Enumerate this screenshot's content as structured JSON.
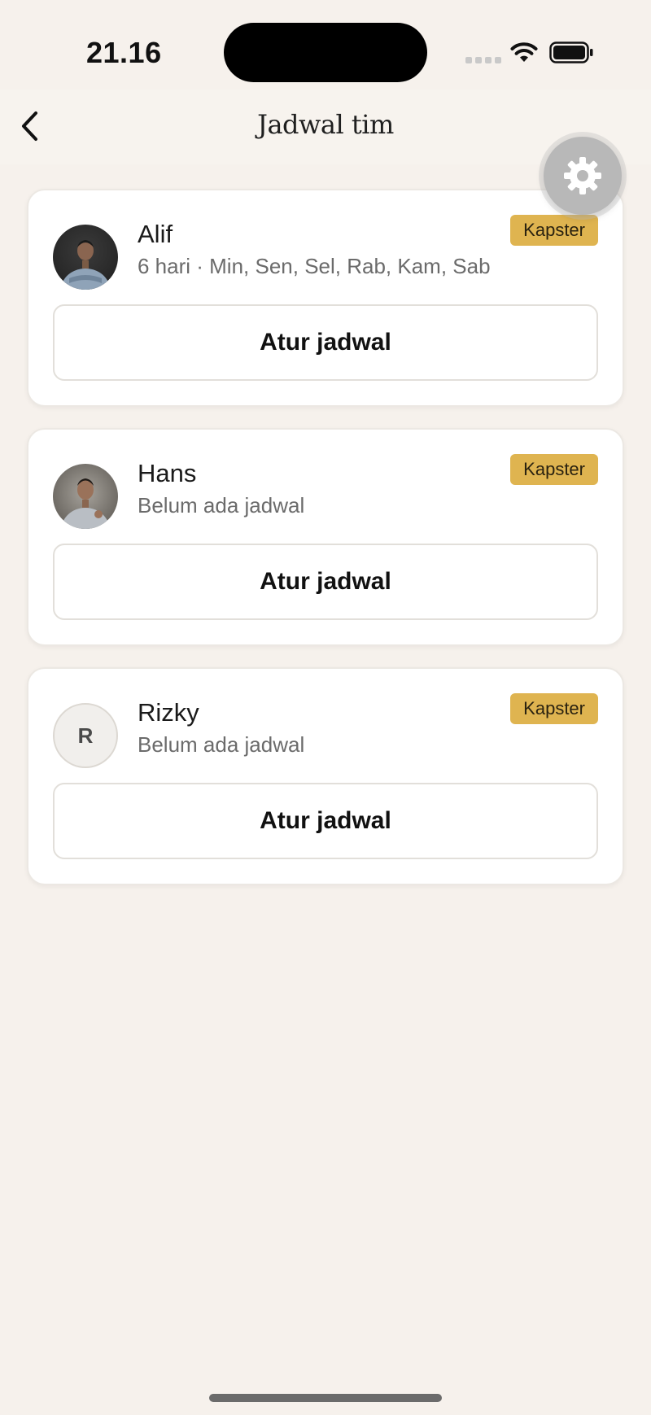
{
  "status_bar": {
    "time": "21.16"
  },
  "nav": {
    "title": "Jadwal tim"
  },
  "staff": [
    {
      "name": "Alif",
      "schedule": "6 hari · Min, Sen, Sel, Rab, Kam, Sab",
      "role": "Kapster",
      "action": "Atur jadwal",
      "avatar_type": "photo"
    },
    {
      "name": "Hans",
      "schedule": "Belum ada jadwal",
      "role": "Kapster",
      "action": "Atur jadwal",
      "avatar_type": "photo"
    },
    {
      "name": "Rizky",
      "schedule": "Belum ada jadwal",
      "role": "Kapster",
      "action": "Atur jadwal",
      "avatar_type": "initial",
      "avatar_initial": "R"
    }
  ],
  "icons": {
    "back": "chevron-left-icon",
    "settings": "gear-icon"
  },
  "colors": {
    "background": "#f6f1ec",
    "badge": "#dfb450",
    "card": "#ffffff"
  }
}
